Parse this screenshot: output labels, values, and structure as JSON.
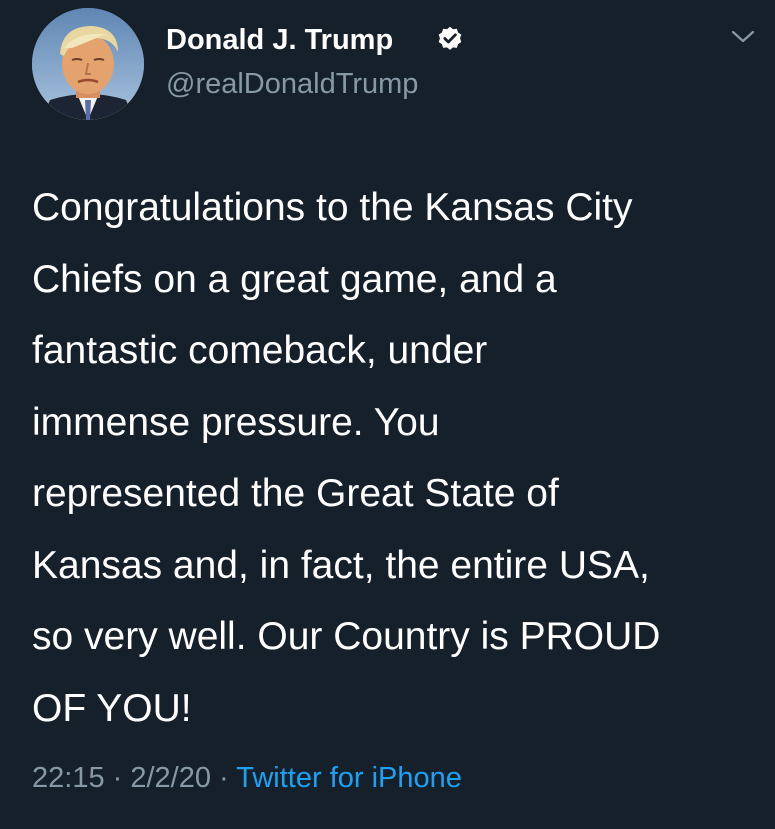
{
  "author": {
    "name": "Donald J. Trump",
    "handle": "@realDonaldTrump",
    "verified": true
  },
  "tweet": {
    "text": "Congratulations to the Kansas City\nChiefs on a great game, and a\nfantastic comeback, under\nimmense pressure. You\nrepresented the Great State of\nKansas and, in fact, the entire USA,\nso very well. Our Country is PROUD\nOF YOU!",
    "time": "22:15",
    "date": "2/2/20",
    "separator": " · ",
    "source": "Twitter for iPhone"
  },
  "icons": {
    "verified": "verified-badge-icon",
    "menu": "chevron-down-icon"
  },
  "colors": {
    "background": "#15202b",
    "primary_text": "#ffffff",
    "secondary_text": "#8899a6",
    "link": "#1da1f2"
  }
}
